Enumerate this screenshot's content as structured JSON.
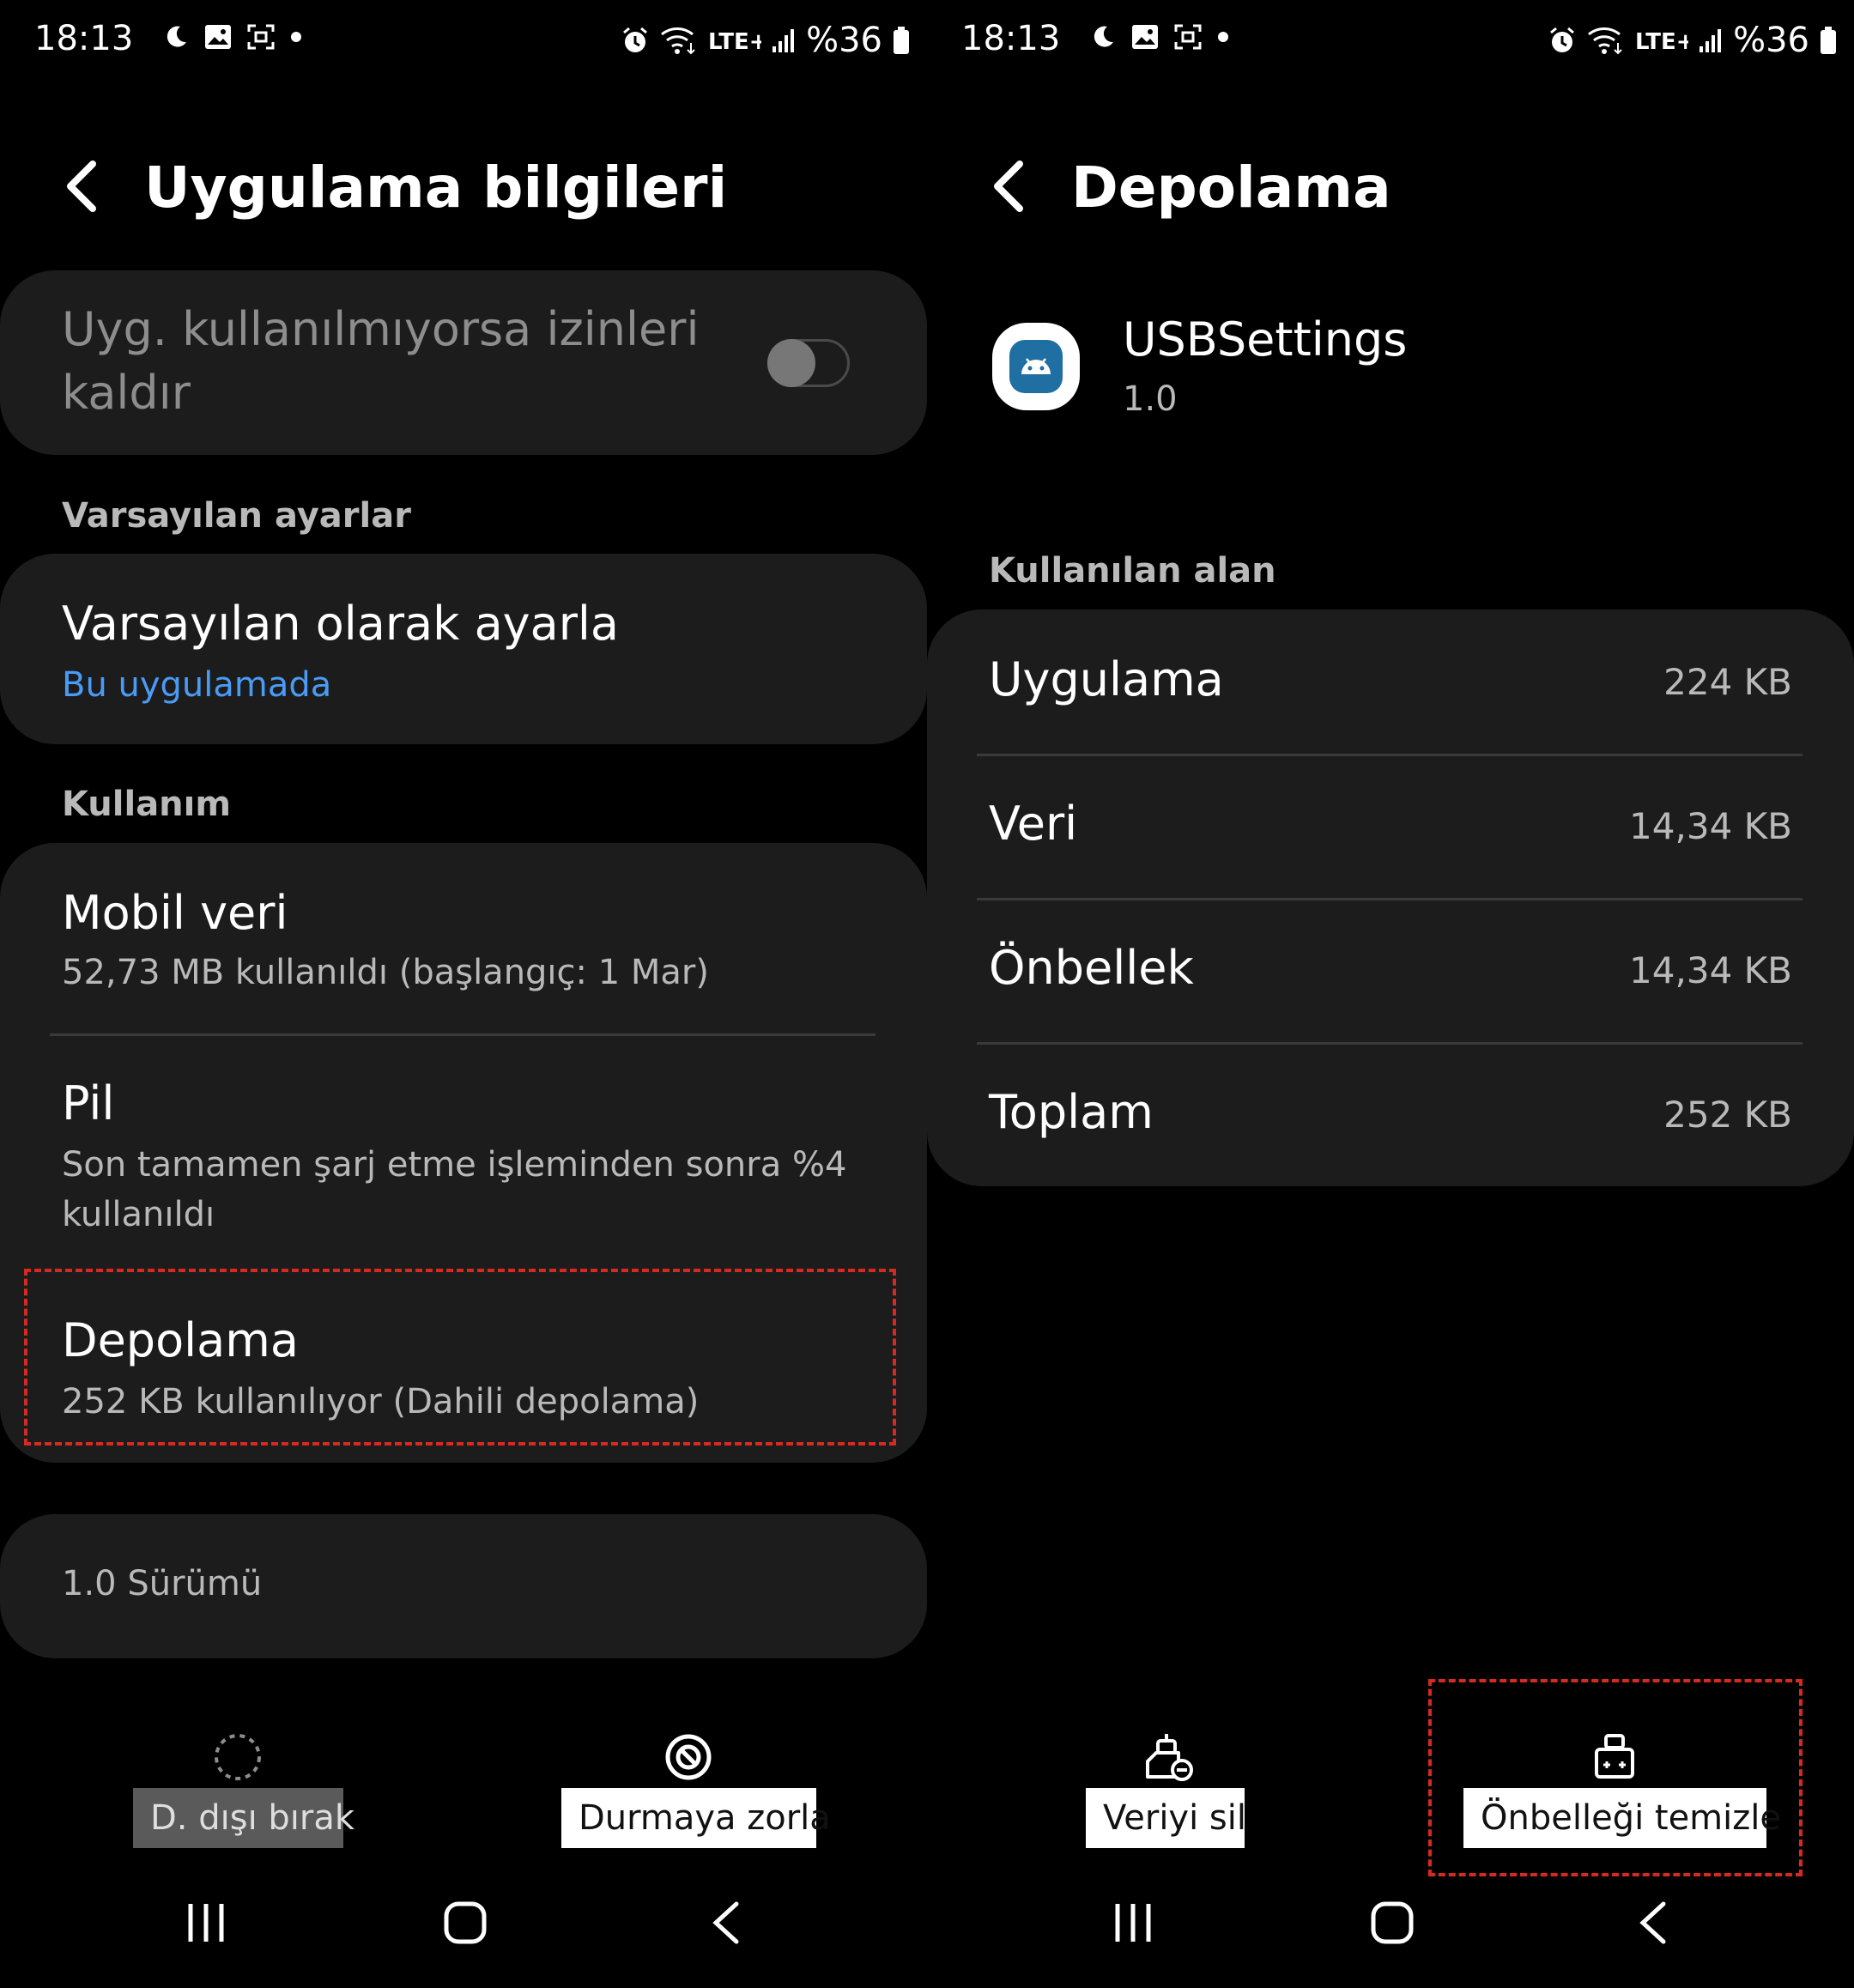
{
  "status_bar": {
    "time": "18:13",
    "battery": "%36",
    "network": "LTE+"
  },
  "left_screen": {
    "title": "Uygulama bilgileri",
    "remove_permissions": {
      "label": "Uyg. kullanılmıyorsa izinleri kaldır",
      "line1": "Uyg. kullanılmıyorsa izinleri",
      "line2": "kaldır",
      "enabled": false
    },
    "defaults_section": {
      "header": "Varsayılan ayarlar",
      "item_title": "Varsayılan olarak ayarla",
      "item_subtitle": "Bu uygulamada"
    },
    "usage_section": {
      "header": "Kullanım",
      "mobile_data": {
        "title": "Mobil veri",
        "subtitle": "52,73 MB kullanıldı (başlangıç: 1 Mar)"
      },
      "battery": {
        "title": "Pil",
        "subtitle_line1": "Son tamamen şarj etme işleminden sonra %4",
        "subtitle_line2": "kullanıldı"
      },
      "storage": {
        "title": "Depolama",
        "subtitle": "252 KB kullanılıyor (Dahili depolama)"
      }
    },
    "version": "1.0 Sürümü",
    "actions": {
      "disable": "D. dışı bırak",
      "force_stop": "Durmaya zorla"
    }
  },
  "right_screen": {
    "title": "Depolama",
    "app": {
      "name": "USBSettings",
      "version": "1.0"
    },
    "used_space_header": "Kullanılan alan",
    "rows": [
      {
        "label": "Uygulama",
        "value": "224 KB"
      },
      {
        "label": "Veri",
        "value": "14,34 KB"
      },
      {
        "label": "Önbellek",
        "value": "14,34 KB"
      },
      {
        "label": "Toplam",
        "value": "252 KB"
      }
    ],
    "actions": {
      "clear_data": "Veriyi sil",
      "clear_cache": "Önbelleği temizle"
    }
  },
  "colors": {
    "background": "#000000",
    "card": "#1c1c1c",
    "accent_link": "#4a9bf5",
    "highlight": "#d42a20",
    "secondary_text": "#b9b9b9"
  },
  "icons": [
    "moon-icon",
    "image-icon",
    "screenshot-icon",
    "dot-icon",
    "alarm-icon",
    "wifi-icon",
    "lte-icon",
    "signal-icon",
    "battery-icon",
    "back-arrow-icon",
    "android-app-icon",
    "disable-icon",
    "force-stop-icon",
    "clear-data-icon",
    "clear-cache-icon",
    "recents-icon",
    "home-icon",
    "back-icon"
  ]
}
